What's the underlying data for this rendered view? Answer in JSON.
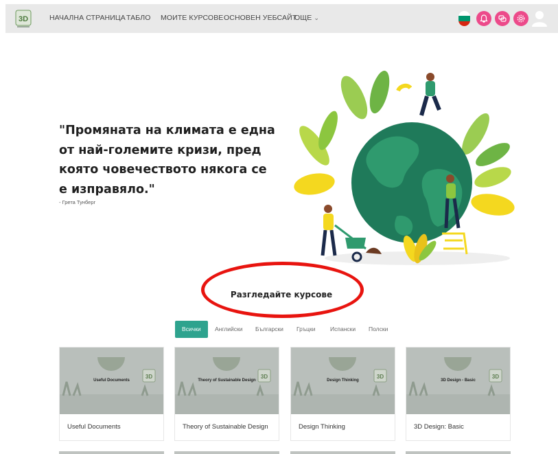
{
  "navbar": {
    "items": [
      "НАЧАЛНА СТРАНИЦА",
      "ТАБЛО",
      "МОИТЕ КУРСОВЕ",
      "ОСНОВЕН УЕБСАЙТ",
      "ОЩЕ"
    ],
    "more_chevron": "⌄",
    "icons": [
      "flag-icon",
      "notification-icon",
      "messages-icon",
      "settings-icon",
      "user-avatar-icon"
    ],
    "accent": "#ec4a8a"
  },
  "hero": {
    "quote": "\"Промяната на климата е една от най-големите кризи, пред която човечеството някога се е изправяло.\"",
    "author": "- Грета Тунберг"
  },
  "section": {
    "title": "Разгледайте курсове",
    "highlight_color": "#e8140f"
  },
  "filters": {
    "items": [
      "Всички",
      "Английски",
      "Български",
      "Гръцки",
      "Испански",
      "Полски"
    ],
    "active": "Всички",
    "active_color": "#2ea38e"
  },
  "courses": [
    {
      "title": "Useful Documents",
      "image_label": "Useful Documents"
    },
    {
      "title": "Theory of Sustainable Design",
      "image_label": "Theory of Sustainable Design"
    },
    {
      "title": "Design Thinking",
      "image_label": "Design Thinking"
    },
    {
      "title": "3D Design: Basic",
      "image_label": "3D Design - Basic"
    }
  ]
}
